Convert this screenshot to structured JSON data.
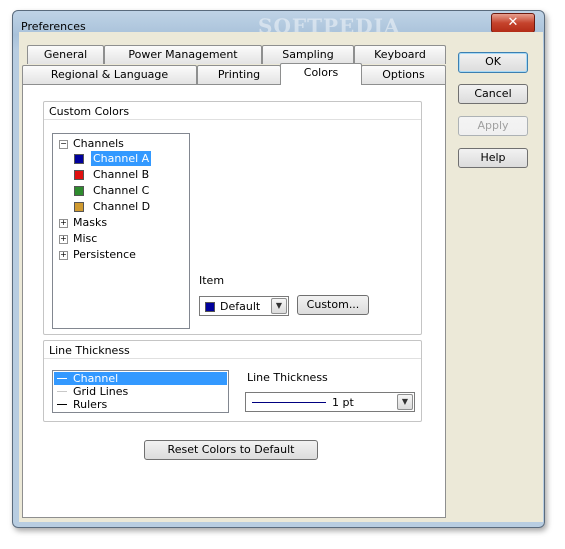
{
  "window": {
    "title": "Preferences",
    "watermark": "SOFTPEDIA",
    "close_glyph": "✕"
  },
  "tabs_row1": [
    "General",
    "Power Management",
    "Sampling",
    "Keyboard"
  ],
  "tabs_row2": [
    "Regional & Language",
    "Printing",
    "Colors",
    "Options"
  ],
  "active_tab": "Colors",
  "side_buttons": {
    "ok": "OK",
    "cancel": "Cancel",
    "apply": "Apply",
    "help": "Help"
  },
  "custom_colors": {
    "title": "Custom Colors",
    "tree": {
      "channels": "Channels",
      "channel_items": [
        {
          "label": "Channel A",
          "color": "#00009c"
        },
        {
          "label": "Channel B",
          "color": "#e01010"
        },
        {
          "label": "Channel C",
          "color": "#2e8b2e"
        },
        {
          "label": "Channel D",
          "color": "#d09a30"
        }
      ],
      "masks": "Masks",
      "misc": "Misc",
      "persistence": "Persistence"
    },
    "item_label": "Item",
    "item_value": "Default",
    "item_color": "#00009c",
    "custom_button": "Custom..."
  },
  "line_thickness": {
    "title": "Line Thickness",
    "list": [
      "Channel",
      "Grid Lines",
      "Rulers"
    ],
    "label": "Line Thickness",
    "value": "1 pt"
  },
  "reset_button": "Reset Colors to Default",
  "colors": {
    "selection": "#3399ff",
    "title_close": "#c5432c"
  }
}
